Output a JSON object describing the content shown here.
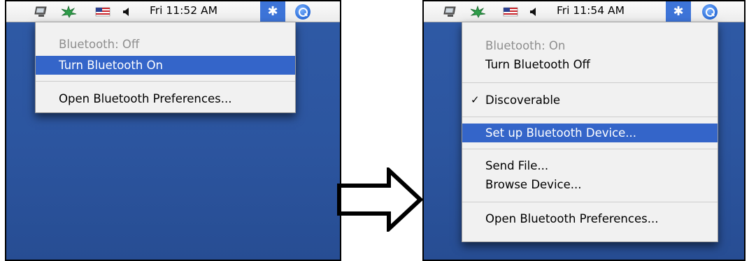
{
  "colors": {
    "desktop": "#2c559f",
    "highlight": "#3465c9",
    "bluetooth_slot": "#3d74d8",
    "disabled_text": "#8e8e8e"
  },
  "left": {
    "menubar": {
      "icons": [
        "monitor-icon",
        "leaf-icon",
        "flag-icon",
        "volume-icon",
        "bluetooth-icon",
        "spotlight-icon"
      ],
      "clock": "Fri 11:52 AM",
      "bluetooth_glyph": "✱"
    },
    "menu": {
      "status": "Bluetooth: Off",
      "toggle": "Turn Bluetooth On",
      "preferences": "Open Bluetooth Preferences..."
    }
  },
  "right": {
    "menubar": {
      "icons": [
        "monitor-icon",
        "leaf-icon",
        "flag-icon",
        "volume-icon",
        "bluetooth-icon",
        "spotlight-icon"
      ],
      "clock": "Fri 11:54 AM",
      "bluetooth_glyph": "✱"
    },
    "menu": {
      "status": "Bluetooth: On",
      "toggle": "Turn Bluetooth Off",
      "check_mark": "✓",
      "discoverable": "Discoverable",
      "setup": "Set up Bluetooth Device...",
      "send_file": "Send File...",
      "browse": "Browse Device...",
      "preferences": "Open Bluetooth Preferences..."
    }
  },
  "transition_icon": "arrow-right-icon"
}
